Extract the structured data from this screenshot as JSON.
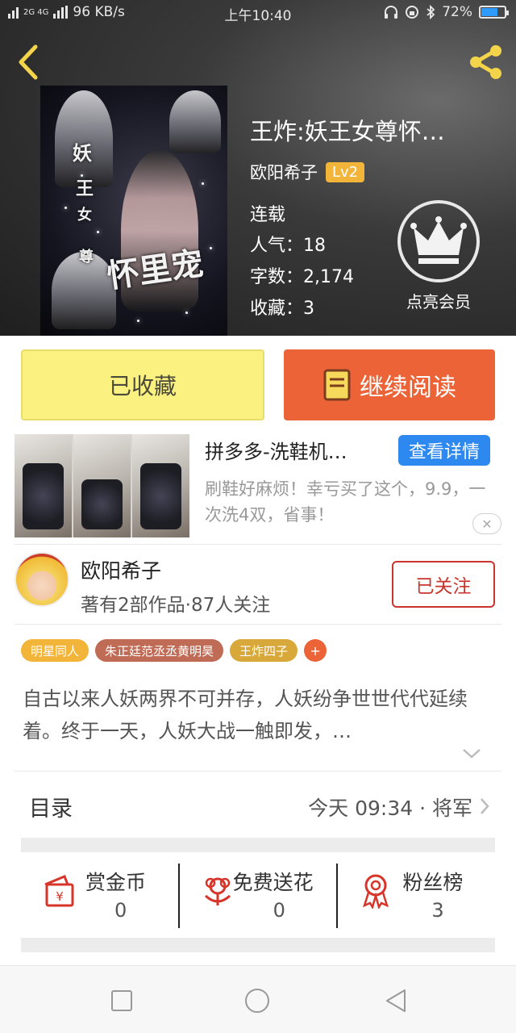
{
  "status_bar": {
    "network": "2G 4G",
    "speed": "96 KB/s",
    "time": "上午10:40",
    "battery": "72%",
    "battery_level": 0.72
  },
  "book": {
    "title": "王炸:妖王女尊怀…",
    "author": "欧阳希子",
    "level": "Lv2",
    "status": "连载",
    "popularity": "人气：18",
    "words": "字数：2,174",
    "favorites": "收藏：3",
    "cover_text_1": "妖",
    "cover_text_2": "王",
    "cover_text_3": "女",
    "cover_text_4": "尊",
    "cover_text_5": "怀里宠"
  },
  "vip": {
    "label": "点亮会员"
  },
  "actions": {
    "favorite_label": "已收藏",
    "read_label": "继续阅读"
  },
  "ad": {
    "title": "拼多多-洗鞋机…",
    "detail_label": "查看详情",
    "description": "刷鞋好麻烦！幸亏买了这个，9.9，一次洗4双，省事！",
    "close_icon": "close-icon"
  },
  "author_card": {
    "name": "欧阳希子",
    "stats": "著有2部作品·87人关注",
    "follow_label": "已关注"
  },
  "tags": [
    {
      "label": "明星同人",
      "color": "#f3b43a"
    },
    {
      "label": "朱正廷范丞丞黄明昊",
      "color": "#c06b55"
    },
    {
      "label": "王炸四子",
      "color": "#d8a93a"
    }
  ],
  "tags_more": "+",
  "synopsis": "自古以来人妖两界不可并存，人妖纷争世世代代延续着。终于一天，人妖大战一触即发，…",
  "toc": {
    "label": "目录",
    "latest": "今天 09:34 · 将军"
  },
  "rewards": [
    {
      "label": "赏金币",
      "value": "0",
      "icon": "red-envelope-icon"
    },
    {
      "label": "免费送花",
      "value": "0",
      "icon": "flower-icon"
    },
    {
      "label": "粉丝榜",
      "value": "3",
      "icon": "medal-icon"
    }
  ],
  "colors": {
    "accent_orange": "#ec6337",
    "favorite_yellow": "#fbf181",
    "detail_blue": "#2d88ef",
    "follow_red": "#c9352c",
    "icon_red": "#d7342a"
  }
}
